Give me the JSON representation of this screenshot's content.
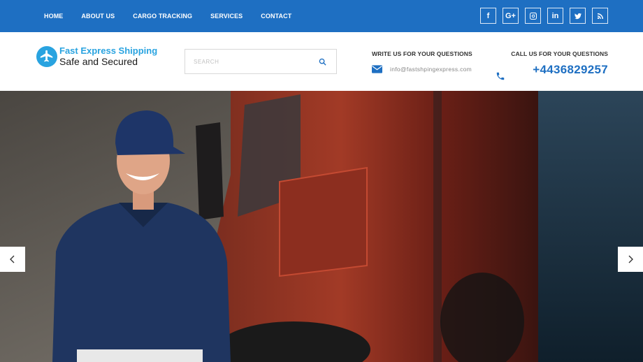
{
  "nav": {
    "items": [
      "HOME",
      "ABOUT US",
      "CARGO TRACKING",
      "SERVICES",
      "CONTACT"
    ]
  },
  "social": {
    "items": [
      {
        "icon": "facebook-icon",
        "glyph": "f"
      },
      {
        "icon": "google-plus-icon",
        "glyph": "G+"
      },
      {
        "icon": "instagram-icon"
      },
      {
        "icon": "linkedin-icon",
        "glyph": "in"
      },
      {
        "icon": "twitter-icon"
      },
      {
        "icon": "rss-icon"
      }
    ]
  },
  "logo": {
    "line1": "Fast Express Shipping",
    "line2": "Safe and Secured",
    "icon": "plane-globe-icon",
    "color": "#29a3e0"
  },
  "search": {
    "placeholder": "SEARCH",
    "value": ""
  },
  "contact": {
    "write_title": "WRITE US FOR YOUR QUESTIONS",
    "email": "info@fastshpingexpress.com",
    "call_title": "CALL US FOR YOUR QUESTIONS",
    "phone": "+4436829257"
  },
  "colors": {
    "topbar": "#1e6fc2",
    "accent": "#1e6fc2"
  }
}
